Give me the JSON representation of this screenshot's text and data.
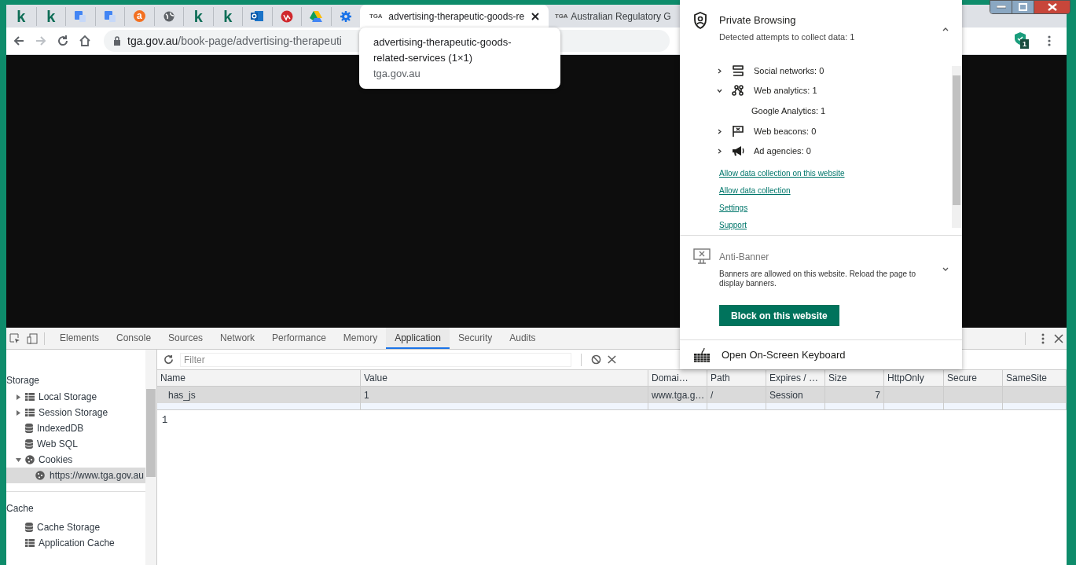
{
  "pinned_tabs": [
    {
      "kind": "letter",
      "glyph": "k"
    },
    {
      "kind": "letter",
      "glyph": "k"
    },
    {
      "kind": "translate"
    },
    {
      "kind": "translate"
    },
    {
      "kind": "orange_letter",
      "glyph": "a"
    },
    {
      "kind": "globe"
    },
    {
      "kind": "letter",
      "glyph": "k"
    },
    {
      "kind": "letter",
      "glyph": "k"
    },
    {
      "kind": "mail"
    },
    {
      "kind": "red_circle"
    },
    {
      "kind": "drive"
    },
    {
      "kind": "gear"
    }
  ],
  "tabs": [
    {
      "badge": "TGA",
      "title": "advertising-therapeutic-goods-re",
      "selected": true
    },
    {
      "badge": "TGA",
      "title": "Australian Regulatory G",
      "selected": false
    }
  ],
  "address_bar": {
    "domain": "tga.gov.au",
    "path": "/book-page/advertising-therapeuti"
  },
  "extension_badge": "1",
  "tooltip": {
    "title": "advertising-therapeutic-goods-related-services (1×1)",
    "domain": "tga.gov.au"
  },
  "popup": {
    "private_browsing": {
      "title": "Private Browsing",
      "subtitle": "Detected attempts to collect data: 1",
      "expanded": true,
      "categories": [
        {
          "kind": "social",
          "label": "Social networks: 0",
          "expanded": false
        },
        {
          "kind": "analytics",
          "label": "Web analytics: 1",
          "expanded": true,
          "children": [
            {
              "label": "Google Analytics: 1"
            }
          ]
        },
        {
          "kind": "beacons",
          "label": "Web beacons: 0",
          "expanded": false
        },
        {
          "kind": "ads",
          "label": "Ad agencies: 0",
          "expanded": false
        }
      ],
      "links": [
        "Allow data collection on this website",
        "Allow data collection",
        "Settings",
        "Support"
      ]
    },
    "anti_banner": {
      "title": "Anti-Banner",
      "text": "Banners are allowed on this website. Reload the page to display banners.",
      "expanded": false,
      "button": "Block on this website"
    },
    "keyboard": {
      "label": "Open On-Screen Keyboard"
    }
  },
  "devtools": {
    "tabs": [
      {
        "label": "Elements",
        "selected": false
      },
      {
        "label": "Console",
        "selected": false
      },
      {
        "label": "Sources",
        "selected": false
      },
      {
        "label": "Network",
        "selected": false
      },
      {
        "label": "Performance",
        "selected": false
      },
      {
        "label": "Memory",
        "selected": false
      },
      {
        "label": "Application",
        "selected": true
      },
      {
        "label": "Security",
        "selected": false
      },
      {
        "label": "Audits",
        "selected": false
      }
    ],
    "sidebar": [
      {
        "heading": "Storage",
        "items": [
          {
            "kind": "grid",
            "label": "Local Storage",
            "expanded": false
          },
          {
            "kind": "grid",
            "label": "Session Storage",
            "expanded": false
          },
          {
            "kind": "db",
            "label": "IndexedDB"
          },
          {
            "kind": "db",
            "label": "Web SQL"
          },
          {
            "kind": "cookie",
            "label": "Cookies",
            "expanded": true,
            "children": [
              {
                "kind": "cookie",
                "label": "https://www.tga.gov.au",
                "selected": true
              }
            ]
          }
        ]
      },
      {
        "heading": "Cache",
        "items": [
          {
            "kind": "db",
            "label": "Cache Storage"
          },
          {
            "kind": "grid",
            "label": "Application Cache"
          }
        ]
      }
    ],
    "filter_placeholder": "Filter",
    "table": {
      "columns": [
        "Name",
        "Value",
        "Domai…",
        "Path",
        "Expires / …",
        "Size",
        "HttpOnly",
        "Secure",
        "SameSite"
      ],
      "rows": [
        {
          "selected": true,
          "cells": [
            "has_js",
            "1",
            "www.tga.g…",
            "/",
            "Session",
            "7",
            "",
            "",
            ""
          ]
        }
      ]
    },
    "preview": "1"
  }
}
